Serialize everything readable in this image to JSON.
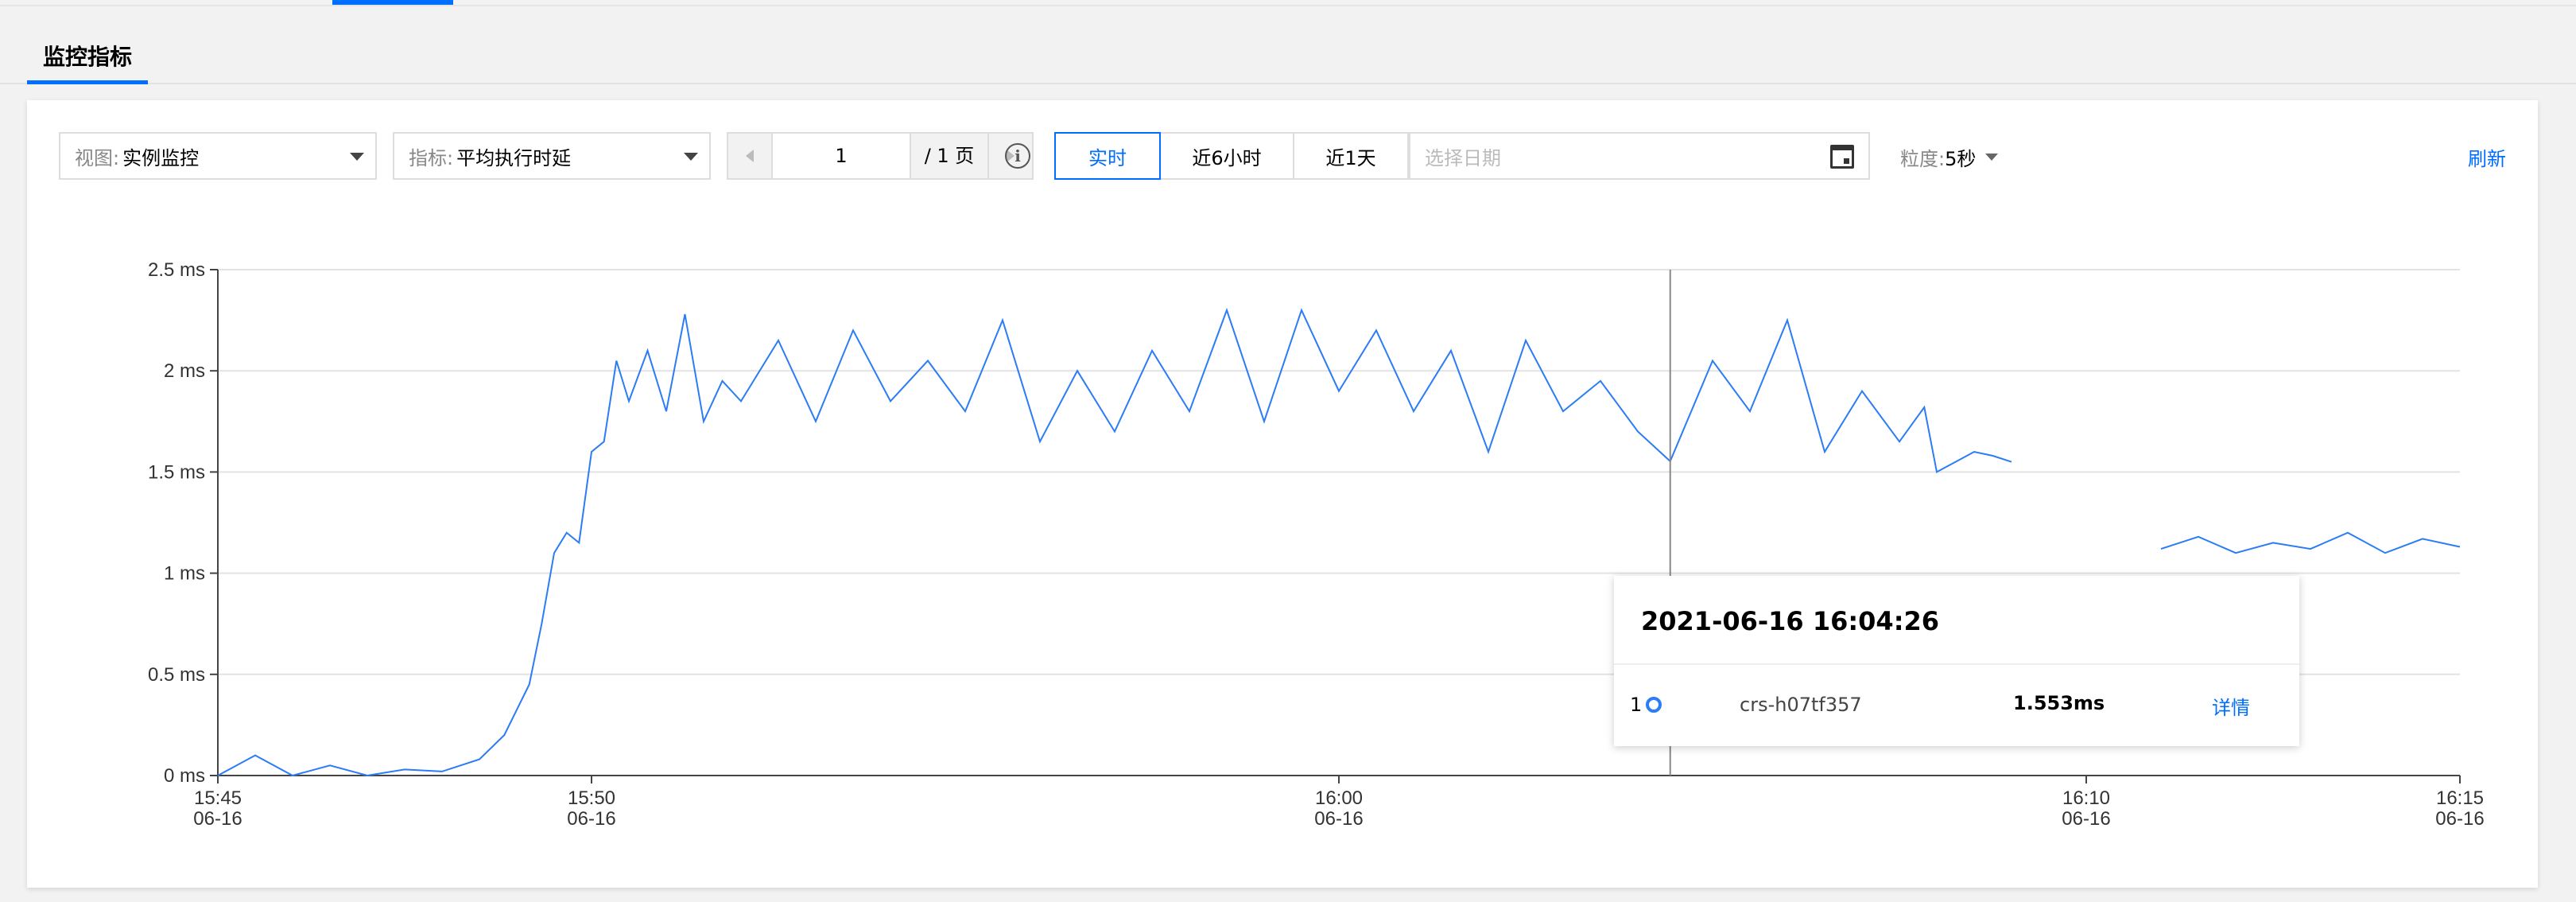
{
  "section": {
    "tab_label": "监控指标"
  },
  "toolbar": {
    "view_label": "视图:",
    "view_value": "实例监控",
    "metric_label": "指标:",
    "metric_value": "平均执行时延",
    "page_current": "1",
    "page_total": "/ 1 页",
    "range_buttons": [
      "实时",
      "近6小时",
      "近1天"
    ],
    "date_placeholder": "选择日期",
    "granularity_label": "粒度:",
    "granularity_value": "5秒",
    "refresh_label": "刷新"
  },
  "colors": {
    "accent": "#006eff",
    "series": "#2b7cf5"
  },
  "tooltip": {
    "time": "2021-06-16 16:04:26",
    "index": "1",
    "instance": "crs-h07tf357",
    "value": "1.553ms",
    "detail_label": "详情"
  },
  "chart_data": {
    "type": "line",
    "title": "",
    "xlabel": "",
    "ylabel": "",
    "y_unit": "ms",
    "ylim": [
      0,
      2.5
    ],
    "y_ticks": [
      0,
      0.5,
      1,
      1.5,
      2,
      2.5
    ],
    "y_tick_labels": [
      "0 ms",
      "0.5 ms",
      "1 ms",
      "1.5 ms",
      "2 ms",
      "2.5 ms"
    ],
    "x_range": [
      "15:45",
      "16:15"
    ],
    "x_ticks": [
      {
        "time": "15:45",
        "date": "06-16"
      },
      {
        "time": "15:50",
        "date": "06-16"
      },
      {
        "time": "16:00",
        "date": "06-16"
      },
      {
        "time": "16:10",
        "date": "06-16"
      },
      {
        "time": "16:15",
        "date": "06-16"
      }
    ],
    "grid": true,
    "crosshair_time": "16:04:26",
    "series": [
      {
        "name": "crs-h07tf357",
        "x": [
          "15:45:00",
          "15:45:30",
          "15:46:00",
          "15:46:30",
          "15:47:00",
          "15:47:30",
          "15:48:00",
          "15:48:30",
          "15:48:50",
          "15:49:10",
          "15:49:20",
          "15:49:30",
          "15:49:40",
          "15:49:50",
          "15:50:00",
          "15:50:10",
          "15:50:20",
          "15:50:30",
          "15:50:45",
          "15:51:00",
          "15:51:15",
          "15:51:30",
          "15:51:45",
          "15:52:00",
          "15:52:30",
          "15:53:00",
          "15:53:30",
          "15:54:00",
          "15:54:30",
          "15:55:00",
          "15:55:30",
          "15:56:00",
          "15:56:30",
          "15:57:00",
          "15:57:30",
          "15:58:00",
          "15:58:30",
          "15:59:00",
          "15:59:30",
          "16:00:00",
          "16:00:30",
          "16:01:00",
          "16:01:30",
          "16:02:00",
          "16:02:30",
          "16:03:00",
          "16:03:30",
          "16:04:00",
          "16:04:26",
          "16:05:00",
          "16:05:30",
          "16:06:00",
          "16:06:30",
          "16:07:00",
          "16:07:30",
          "16:07:50",
          "16:08:00",
          "16:08:15",
          "16:08:30",
          "16:08:45",
          "16:09:00"
        ],
        "values": [
          0,
          0.1,
          0,
          0.05,
          0,
          0.03,
          0.02,
          0.08,
          0.2,
          0.45,
          0.75,
          1.1,
          1.2,
          1.15,
          1.6,
          1.65,
          2.05,
          1.85,
          2.1,
          1.8,
          2.28,
          1.75,
          1.95,
          1.85,
          2.15,
          1.75,
          2.2,
          1.85,
          2.05,
          1.8,
          2.25,
          1.65,
          2.0,
          1.7,
          2.1,
          1.8,
          2.3,
          1.75,
          2.3,
          1.9,
          2.2,
          1.8,
          2.1,
          1.6,
          2.15,
          1.8,
          1.95,
          1.7,
          1.553,
          2.05,
          1.8,
          2.25,
          1.6,
          1.9,
          1.65,
          1.82,
          1.5,
          1.55,
          1.6,
          1.58,
          1.55
        ]
      },
      {
        "name": "",
        "x": [
          "16:11:00",
          "16:11:30",
          "16:12:00",
          "16:12:30",
          "16:13:00",
          "16:13:30",
          "16:14:00",
          "16:14:30",
          "16:15:00"
        ],
        "values": [
          1.12,
          1.18,
          1.1,
          1.15,
          1.12,
          1.2,
          1.1,
          1.17,
          1.13
        ]
      }
    ]
  }
}
